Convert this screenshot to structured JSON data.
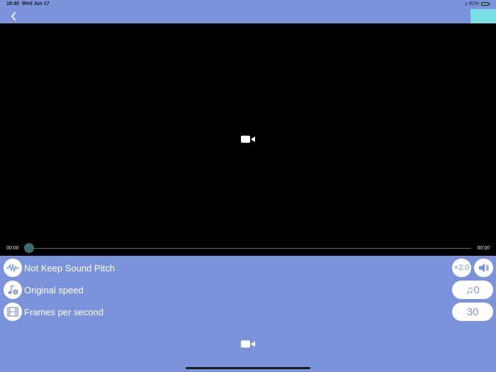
{
  "status_bar": {
    "time": "18:40",
    "date": "Wed Jun 17",
    "battery": "81%"
  },
  "player": {
    "current_time": "00:00",
    "duration": "00:00",
    "progress": 0
  },
  "controls": {
    "pitch_label": "Not Keep Sound Pitch",
    "speed_value": "×2.0",
    "speed_label": "Original speed",
    "music_value": "♫0",
    "fps_label": "Frames per second",
    "fps_value": "30"
  },
  "colors": {
    "background": "#7b93dc",
    "accent": "#79e0e8",
    "thumb": "#3c6e6e"
  },
  "icons": [
    "back-icon",
    "video-camera-icon",
    "waveform-icon",
    "music-note-icon",
    "film-strip-icon",
    "speaker-icon",
    "moon-icon",
    "battery-icon"
  ]
}
